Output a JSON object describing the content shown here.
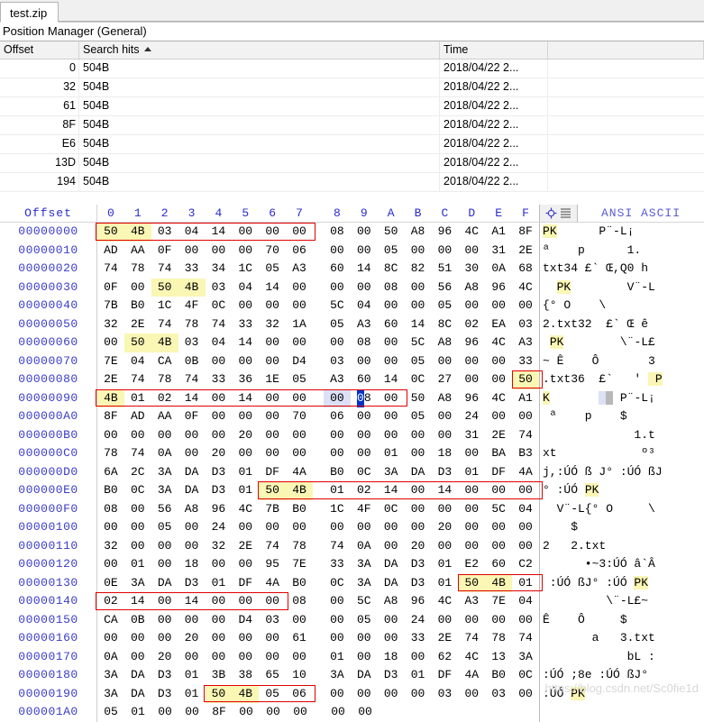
{
  "window": {
    "tab_label": "test.zip",
    "position_manager_title": "Position Manager (General)"
  },
  "hits_table": {
    "columns": [
      "Offset",
      "Search hits",
      "Time"
    ],
    "sort_column": "Search hits",
    "sort_direction": "ascending",
    "rows": [
      {
        "offset": "0",
        "hit": "504B",
        "time": "2018/04/22  2..."
      },
      {
        "offset": "32",
        "hit": "504B",
        "time": "2018/04/22  2..."
      },
      {
        "offset": "61",
        "hit": "504B",
        "time": "2018/04/22  2..."
      },
      {
        "offset": "8F",
        "hit": "504B",
        "time": "2018/04/22  2..."
      },
      {
        "offset": "E6",
        "hit": "504B",
        "time": "2018/04/22  2..."
      },
      {
        "offset": "13D",
        "hit": "504B",
        "time": "2018/04/22  2..."
      },
      {
        "offset": "194",
        "hit": "504B",
        "time": "2018/04/22  2..."
      }
    ]
  },
  "hex_view": {
    "offset_header": "Offset",
    "column_headers": [
      "0",
      "1",
      "2",
      "3",
      "4",
      "5",
      "6",
      "7",
      "8",
      "9",
      "A",
      "B",
      "C",
      "D",
      "E",
      "F"
    ],
    "ascii_header": "ANSI ASCII",
    "ascii_icons": [
      "crosshair-icon",
      "lines-icon"
    ],
    "rows": [
      {
        "offset": "00000000",
        "bytes": [
          "50",
          "4B",
          "03",
          "04",
          "14",
          "00",
          "00",
          "00",
          "08",
          "00",
          "50",
          "A8",
          "96",
          "4C",
          "A1",
          "8F"
        ],
        "ascii": "PK      P¨-L¡"
      },
      {
        "offset": "00000010",
        "bytes": [
          "AD",
          "AA",
          "0F",
          "00",
          "00",
          "00",
          "70",
          "06",
          "00",
          "00",
          "05",
          "00",
          "00",
          "00",
          "31",
          "2E"
        ],
        "ascii": "­ª    p      1."
      },
      {
        "offset": "00000020",
        "bytes": [
          "74",
          "78",
          "74",
          "33",
          "34",
          "1C",
          "05",
          "A3",
          "60",
          "14",
          "8C",
          "82",
          "51",
          "30",
          "0A",
          "68"
        ],
        "ascii": "txt34 £` Œ,Q0 h"
      },
      {
        "offset": "00000030",
        "bytes": [
          "0F",
          "00",
          "50",
          "4B",
          "03",
          "04",
          "14",
          "00",
          "00",
          "00",
          "08",
          "00",
          "56",
          "A8",
          "96",
          "4C"
        ],
        "ascii": "  PK        V¨-L"
      },
      {
        "offset": "00000040",
        "bytes": [
          "7B",
          "B0",
          "1C",
          "4F",
          "0C",
          "00",
          "00",
          "00",
          "5C",
          "04",
          "00",
          "00",
          "05",
          "00",
          "00",
          "00"
        ],
        "ascii": "{° O    \\"
      },
      {
        "offset": "00000050",
        "bytes": [
          "32",
          "2E",
          "74",
          "78",
          "74",
          "33",
          "32",
          "1A",
          "05",
          "A3",
          "60",
          "14",
          "8C",
          "02",
          "EA",
          "03"
        ],
        "ascii": "2.txt32  £` Œ ê"
      },
      {
        "offset": "00000060",
        "bytes": [
          "00",
          "50",
          "4B",
          "03",
          "04",
          "14",
          "00",
          "00",
          "00",
          "08",
          "00",
          "5C",
          "A8",
          "96",
          "4C",
          "A3"
        ],
        "ascii": " PK        \\¨-L£"
      },
      {
        "offset": "00000070",
        "bytes": [
          "7E",
          "04",
          "CA",
          "0B",
          "00",
          "00",
          "00",
          "D4",
          "03",
          "00",
          "00",
          "05",
          "00",
          "00",
          "00",
          "33"
        ],
        "ascii": "~ Ê    Ô       3"
      },
      {
        "offset": "00000080",
        "bytes": [
          "2E",
          "74",
          "78",
          "74",
          "33",
          "36",
          "1E",
          "05",
          "A3",
          "60",
          "14",
          "0C",
          "27",
          "00",
          "00",
          "50"
        ],
        "ascii": ".txt36  £`   '  P"
      },
      {
        "offset": "00000090",
        "bytes": [
          "4B",
          "01",
          "02",
          "14",
          "00",
          "14",
          "00",
          "00",
          "00",
          "08",
          "00",
          "50",
          "A8",
          "96",
          "4C",
          "A1"
        ],
        "ascii": "K          P¨-L¡"
      },
      {
        "offset": "000000A0",
        "bytes": [
          "8F",
          "AD",
          "AA",
          "0F",
          "00",
          "00",
          "00",
          "70",
          "06",
          "00",
          "00",
          "05",
          "00",
          "24",
          "00",
          "00"
        ],
        "ascii": " ­ª    p    $"
      },
      {
        "offset": "000000B0",
        "bytes": [
          "00",
          "00",
          "00",
          "00",
          "00",
          "20",
          "00",
          "00",
          "00",
          "00",
          "00",
          "00",
          "00",
          "31",
          "2E",
          "74"
        ],
        "ascii": "             1.t"
      },
      {
        "offset": "000000C0",
        "bytes": [
          "78",
          "74",
          "0A",
          "00",
          "20",
          "00",
          "00",
          "00",
          "00",
          "00",
          "01",
          "00",
          "18",
          "00",
          "BA",
          "B3"
        ],
        "ascii": "xt            º³"
      },
      {
        "offset": "000000D0",
        "bytes": [
          "6A",
          "2C",
          "3A",
          "DA",
          "D3",
          "01",
          "DF",
          "4A",
          "B0",
          "0C",
          "3A",
          "DA",
          "D3",
          "01",
          "DF",
          "4A"
        ],
        "ascii": "j,:ÚÓ ß J° :ÚÓ ßJ"
      },
      {
        "offset": "000000E0",
        "bytes": [
          "B0",
          "0C",
          "3A",
          "DA",
          "D3",
          "01",
          "50",
          "4B",
          "01",
          "02",
          "14",
          "00",
          "14",
          "00",
          "00",
          "00"
        ],
        "ascii": "° :ÚÓ PK"
      },
      {
        "offset": "000000F0",
        "bytes": [
          "08",
          "00",
          "56",
          "A8",
          "96",
          "4C",
          "7B",
          "B0",
          "1C",
          "4F",
          "0C",
          "00",
          "00",
          "00",
          "5C",
          "04"
        ],
        "ascii": "  V¨-L{° O     \\"
      },
      {
        "offset": "00000100",
        "bytes": [
          "00",
          "00",
          "05",
          "00",
          "24",
          "00",
          "00",
          "00",
          "00",
          "00",
          "00",
          "00",
          "20",
          "00",
          "00",
          "00"
        ],
        "ascii": "    $"
      },
      {
        "offset": "00000110",
        "bytes": [
          "32",
          "00",
          "00",
          "00",
          "32",
          "2E",
          "74",
          "78",
          "74",
          "0A",
          "00",
          "20",
          "00",
          "00",
          "00",
          "00"
        ],
        "ascii": "2   2.txt"
      },
      {
        "offset": "00000120",
        "bytes": [
          "00",
          "01",
          "00",
          "18",
          "00",
          "00",
          "95",
          "7E",
          "33",
          "3A",
          "DA",
          "D3",
          "01",
          "E2",
          "60",
          "C2"
        ],
        "ascii": "      •~3:ÚÓ â`Â"
      },
      {
        "offset": "00000130",
        "bytes": [
          "0E",
          "3A",
          "DA",
          "D3",
          "01",
          "DF",
          "4A",
          "B0",
          "0C",
          "3A",
          "DA",
          "D3",
          "01",
          "50",
          "4B",
          "01"
        ],
        "ascii": " :ÚÓ ßJ° :ÚÓ PK"
      },
      {
        "offset": "00000140",
        "bytes": [
          "02",
          "14",
          "00",
          "14",
          "00",
          "00",
          "00",
          "08",
          "00",
          "5C",
          "A8",
          "96",
          "4C",
          "A3",
          "7E",
          "04"
        ],
        "ascii": "         \\¨-L£~"
      },
      {
        "offset": "00000150",
        "bytes": [
          "CA",
          "0B",
          "00",
          "00",
          "00",
          "D4",
          "03",
          "00",
          "00",
          "05",
          "00",
          "24",
          "00",
          "00",
          "00",
          "00"
        ],
        "ascii": "Ê    Ô     $"
      },
      {
        "offset": "00000160",
        "bytes": [
          "00",
          "00",
          "00",
          "20",
          "00",
          "00",
          "00",
          "61",
          "00",
          "00",
          "00",
          "33",
          "2E",
          "74",
          "78",
          "74"
        ],
        "ascii": "       a   3.txt"
      },
      {
        "offset": "00000170",
        "bytes": [
          "0A",
          "00",
          "20",
          "00",
          "00",
          "00",
          "00",
          "00",
          "01",
          "00",
          "18",
          "00",
          "62",
          "4C",
          "13",
          "3A"
        ],
        "ascii": "            bL :"
      },
      {
        "offset": "00000180",
        "bytes": [
          "3A",
          "DA",
          "D3",
          "01",
          "3B",
          "38",
          "65",
          "10",
          "3A",
          "DA",
          "D3",
          "01",
          "DF",
          "4A",
          "B0",
          "0C"
        ],
        "ascii": ":ÚÓ ;8e :ÚÓ ßJ°"
      },
      {
        "offset": "00000190",
        "bytes": [
          "3A",
          "DA",
          "D3",
          "01",
          "50",
          "4B",
          "05",
          "06",
          "00",
          "00",
          "00",
          "00",
          "03",
          "00",
          "03",
          "00"
        ],
        "ascii": ":ÚÓ PK"
      },
      {
        "offset": "000001A0",
        "bytes": [
          "05",
          "01",
          "00",
          "00",
          "8F",
          "00",
          "00",
          "00",
          "00",
          "00"
        ],
        "ascii": ""
      }
    ]
  },
  "colors": {
    "hit_highlight": "#faf6b4",
    "search_box_border": "#e00000",
    "cursor_selection": "#0033cc",
    "offset_text": "#3b3bc8",
    "header_text": "#2a2ad0"
  },
  "watermark": {
    "right": "https://blog.csdn.net/Sc0fie1d",
    "left": ""
  }
}
